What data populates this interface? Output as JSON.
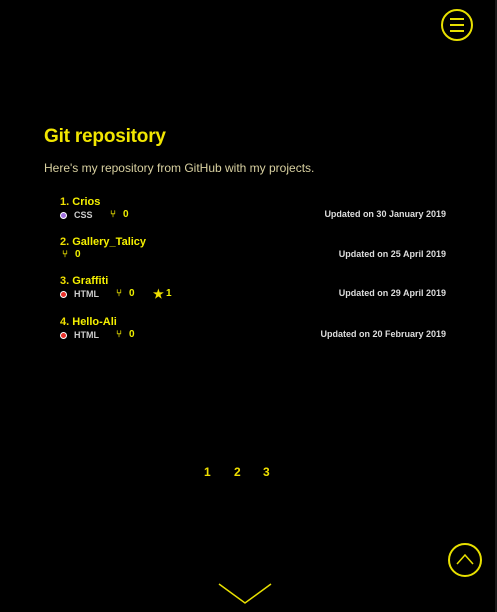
{
  "section": {
    "title": "Git repository",
    "intro": "Here's my repository from GitHub with my projects."
  },
  "repos": [
    {
      "num": "1.",
      "name": "Crios",
      "lang": "CSS",
      "lang_color": "#a070e0",
      "forks": "0",
      "stars": "",
      "updated": "Updated on 30 January 2019"
    },
    {
      "num": "2.",
      "name": "Gallery_Talicy",
      "lang": "",
      "lang_color": "",
      "forks": "0",
      "stars": "",
      "updated": "Updated on 25 April 2019"
    },
    {
      "num": "3.",
      "name": "Graffiti",
      "lang": "HTML",
      "lang_color": "#e8302a",
      "forks": "0",
      "stars": "1",
      "updated": "Updated on 29 April 2019"
    },
    {
      "num": "4.",
      "name": "Hello-Ali",
      "lang": "HTML",
      "lang_color": "#e8302a",
      "forks": "0",
      "stars": "",
      "updated": "Updated on 20 February 2019"
    }
  ],
  "pagination": [
    "1",
    "2",
    "3"
  ],
  "icons": {
    "menu": "hamburger-icon",
    "fork": "fork-icon",
    "star": "star-icon",
    "scroll_top": "chevron-up-icon",
    "scroll_down": "chevron-down-icon"
  },
  "colors": {
    "accent": "#f0e000",
    "background": "#000000"
  }
}
